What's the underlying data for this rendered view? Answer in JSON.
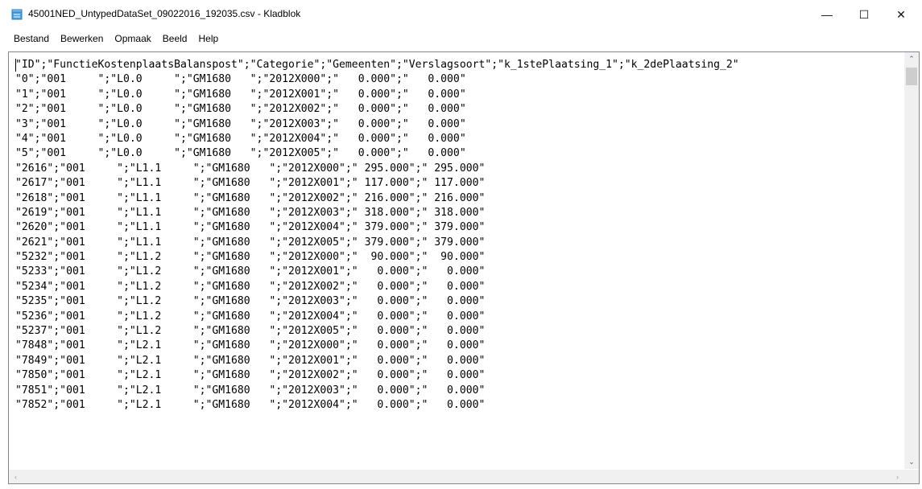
{
  "window": {
    "title": "45001NED_UntypedDataSet_09022016_192035.csv - Kladblok",
    "minimize_glyph": "—",
    "maximize_glyph": "☐",
    "close_glyph": "✕",
    "icon": "notepad-icon"
  },
  "menu": {
    "items": [
      "Bestand",
      "Bewerken",
      "Opmaak",
      "Beeld",
      "Help"
    ]
  },
  "document": {
    "lines": [
      "\"ID\";\"FunctieKostenplaatsBalanspost\";\"Categorie\";\"Gemeenten\";\"Verslagsoort\";\"k_1stePlaatsing_1\";\"k_2dePlaatsing_2\"",
      "\"0\";\"001     \";\"L0.0     \";\"GM1680   \";\"2012X000\";\"   0.000\";\"   0.000\"",
      "\"1\";\"001     \";\"L0.0     \";\"GM1680   \";\"2012X001\";\"   0.000\";\"   0.000\"",
      "\"2\";\"001     \";\"L0.0     \";\"GM1680   \";\"2012X002\";\"   0.000\";\"   0.000\"",
      "\"3\";\"001     \";\"L0.0     \";\"GM1680   \";\"2012X003\";\"   0.000\";\"   0.000\"",
      "\"4\";\"001     \";\"L0.0     \";\"GM1680   \";\"2012X004\";\"   0.000\";\"   0.000\"",
      "\"5\";\"001     \";\"L0.0     \";\"GM1680   \";\"2012X005\";\"   0.000\";\"   0.000\"",
      "\"2616\";\"001     \";\"L1.1     \";\"GM1680   \";\"2012X000\";\" 295.000\";\" 295.000\"",
      "\"2617\";\"001     \";\"L1.1     \";\"GM1680   \";\"2012X001\";\" 117.000\";\" 117.000\"",
      "\"2618\";\"001     \";\"L1.1     \";\"GM1680   \";\"2012X002\";\" 216.000\";\" 216.000\"",
      "\"2619\";\"001     \";\"L1.1     \";\"GM1680   \";\"2012X003\";\" 318.000\";\" 318.000\"",
      "\"2620\";\"001     \";\"L1.1     \";\"GM1680   \";\"2012X004\";\" 379.000\";\" 379.000\"",
      "\"2621\";\"001     \";\"L1.1     \";\"GM1680   \";\"2012X005\";\" 379.000\";\" 379.000\"",
      "\"5232\";\"001     \";\"L1.2     \";\"GM1680   \";\"2012X000\";\"  90.000\";\"  90.000\"",
      "\"5233\";\"001     \";\"L1.2     \";\"GM1680   \";\"2012X001\";\"   0.000\";\"   0.000\"",
      "\"5234\";\"001     \";\"L1.2     \";\"GM1680   \";\"2012X002\";\"   0.000\";\"   0.000\"",
      "\"5235\";\"001     \";\"L1.2     \";\"GM1680   \";\"2012X003\";\"   0.000\";\"   0.000\"",
      "\"5236\";\"001     \";\"L1.2     \";\"GM1680   \";\"2012X004\";\"   0.000\";\"   0.000\"",
      "\"5237\";\"001     \";\"L1.2     \";\"GM1680   \";\"2012X005\";\"   0.000\";\"   0.000\"",
      "\"7848\";\"001     \";\"L2.1     \";\"GM1680   \";\"2012X000\";\"   0.000\";\"   0.000\"",
      "\"7849\";\"001     \";\"L2.1     \";\"GM1680   \";\"2012X001\";\"   0.000\";\"   0.000\"",
      "\"7850\";\"001     \";\"L2.1     \";\"GM1680   \";\"2012X002\";\"   0.000\";\"   0.000\"",
      "\"7851\";\"001     \";\"L2.1     \";\"GM1680   \";\"2012X003\";\"   0.000\";\"   0.000\"",
      "\"7852\";\"001     \";\"L2.1     \";\"GM1680   \";\"2012X004\";\"   0.000\";\"   0.000\""
    ]
  },
  "scrollbars": {
    "up_glyph": "⌃",
    "down_glyph": "⌄",
    "left_glyph": "‹",
    "right_glyph": "›"
  }
}
